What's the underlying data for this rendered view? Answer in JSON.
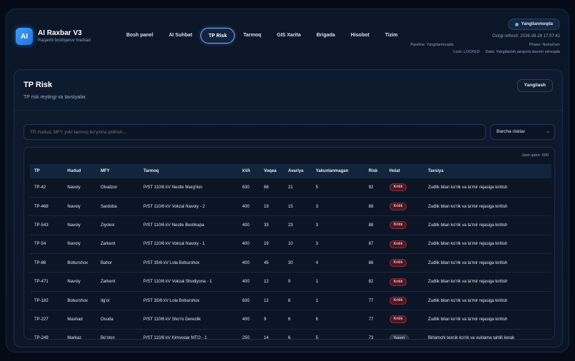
{
  "app": {
    "logo": "AI",
    "title": "AI Raxbar V3",
    "subtitle": "Raqamli boshqaruv markazi"
  },
  "nav": [
    {
      "label": "Bosh panel",
      "active": false
    },
    {
      "label": "AI Suhbat",
      "active": false
    },
    {
      "label": "TP Risk",
      "active": true
    },
    {
      "label": "Tarmoq",
      "active": false
    },
    {
      "label": "GIS Xarita",
      "active": false
    },
    {
      "label": "Brigada",
      "active": false
    },
    {
      "label": "Hisobot",
      "active": false
    },
    {
      "label": "Tizim",
      "active": false
    }
  ],
  "status": {
    "pill": "Yangilanmoqda",
    "refresh": "Oxirgi refresh: 2026-08-28 17:07:42",
    "pipeline": "Pipeline: Yangilanmoqda",
    "phase": "Phase: Noma'lum",
    "lock": "Lock: LOCKED",
    "data": "Data: Yangilanish jarayoni davom etmoqda"
  },
  "page": {
    "title": "TP Risk",
    "subtitle": "TP risk reytingi va tavsiyalar.",
    "refresh_button": "Yangilash"
  },
  "search": {
    "placeholder": "TP, hudud, MFY yoki tarmoq bo'yicha qidirish..."
  },
  "filter": {
    "selected": "Barcha risklar"
  },
  "table": {
    "rowcount": "Jami qator: 500",
    "columns": [
      "TP",
      "Hudud",
      "MFY",
      "Tarmoq",
      "kVA",
      "Voqea",
      "Avariya",
      "Yakunlanmagan",
      "Risk",
      "Holat",
      "Tavsiya"
    ],
    "rows": [
      [
        "TP-42",
        "Navoiy",
        "Olvalizor",
        "P/ST 110/6 kV Nestle Marg'ilon",
        "630",
        "68",
        "21",
        "5",
        "92",
        "Kritik",
        "Zudlik bilan ko'rik va ta'mir rejasiga kiritish"
      ],
      [
        "TP-468",
        "Navoiy",
        "Sardoba",
        "P/ST 110/6 kV Vokzal Navoiy - 2",
        "400",
        "19",
        "15",
        "3",
        "88",
        "Kritik",
        "Zudlik bilan ko'rik va ta'mir rejasiga kiritish"
      ],
      [
        "TP-543",
        "Navoiy",
        "Ziyokor",
        "P/ST 110/6 kV Nestle Beshkapa",
        "400",
        "33",
        "23",
        "3",
        "88",
        "Kritik",
        "Zudlik bilan ko'rik va ta'mir rejasiga kiritish"
      ],
      [
        "TP-54",
        "Navoiy",
        "Zarkent",
        "P/ST 110/6 kV Vokzal Navoiy - 1",
        "400",
        "19",
        "10",
        "3",
        "87",
        "Kritik",
        "Zudlik bilan ko'rik va ta'mir rejasiga kiritish"
      ],
      [
        "TP-88",
        "Boburshox",
        "Bahor",
        "P/ST 35/6 kV Lola Boburshox",
        "400",
        "45",
        "30",
        "4",
        "86",
        "Kritik",
        "Zudlik bilan ko'rik va ta'mir rejasiga kiritish"
      ],
      [
        "TP-471",
        "Navoiy",
        "Zarkent",
        "P/ST 110/6 kV Vokzal Shodiyona - 1",
        "400",
        "12",
        "9",
        "1",
        "82",
        "Kritik",
        "Zudlik bilan ko'rik va ta'mir rejasiga kiritish"
      ],
      [
        "TP-182",
        "Boburshox",
        "Ilg'or",
        "P/ST 35/6 kV Lola Boburshox",
        "630",
        "12",
        "8",
        "1",
        "77",
        "Kritik",
        "Zudlik bilan ko'rik va ta'mir rejasiga kiritish"
      ],
      [
        "TP-227",
        "Mashad",
        "Osuda",
        "P/ST 110/6 kV Sho'ro Derezlik",
        "400",
        "9",
        "6",
        "6",
        "77",
        "Kritik",
        "Zudlik bilan ko'rik va ta'mir rejasiga kiritish"
      ],
      [
        "TP-249",
        "Markaz",
        "Bo'ston",
        "P/ST 110/6 kV Kimyogar MTQ - 1",
        "250",
        "14",
        "6",
        "5",
        "73",
        "Yuqori",
        "Birlamchi texnik ko'rik va yuklama tahlili kerak"
      ]
    ]
  },
  "colors": {
    "accent": "#6fb1ff",
    "critical_badge_bg": "#4a1822",
    "critical_badge_text": "#ffb3bf"
  }
}
